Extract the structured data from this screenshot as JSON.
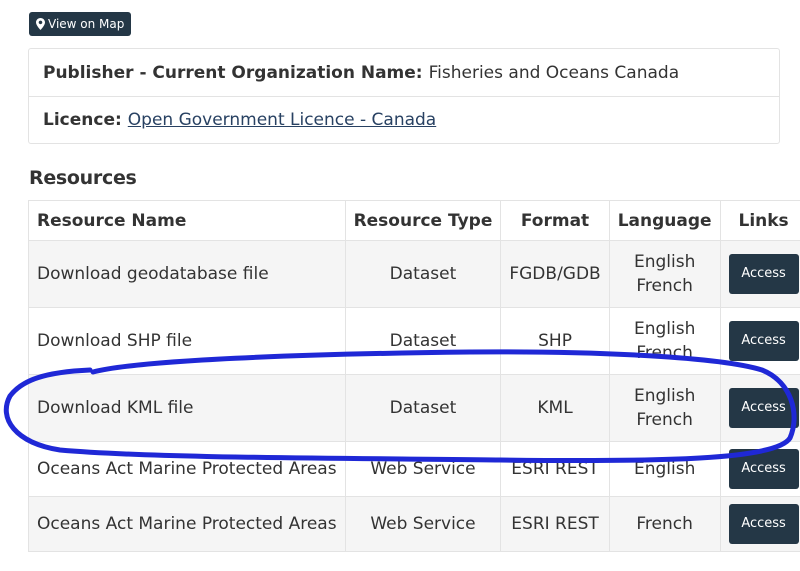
{
  "map_button": {
    "label": "View on Map",
    "icon": "map-marker-icon"
  },
  "publisher": {
    "label": "Publisher - Current Organization Name:",
    "value": "Fisheries and Oceans Canada"
  },
  "licence": {
    "label": "Licence:",
    "value": "Open Government Licence - Canada"
  },
  "resources": {
    "heading": "Resources",
    "columns": [
      "Resource Name",
      "Resource Type",
      "Format",
      "Language",
      "Links"
    ],
    "rows": [
      {
        "name": "Download geodatabase file",
        "type": "Dataset",
        "format": "FGDB/GDB",
        "languages": [
          "English",
          "French"
        ],
        "link": "Access"
      },
      {
        "name": "Download SHP file",
        "type": "Dataset",
        "format": "SHP",
        "languages": [
          "English",
          "French"
        ],
        "link": "Access"
      },
      {
        "name": "Download KML file",
        "type": "Dataset",
        "format": "KML",
        "languages": [
          "English",
          "French"
        ],
        "link": "Access"
      },
      {
        "name": "Oceans Act Marine Protected Areas",
        "type": "Web Service",
        "format": "ESRI REST",
        "languages": [
          "English"
        ],
        "link": "Access"
      },
      {
        "name": "Oceans Act Marine Protected Areas",
        "type": "Web Service",
        "format": "ESRI REST",
        "languages": [
          "French"
        ],
        "link": "Access"
      }
    ]
  },
  "colors": {
    "button_bg": "#243746",
    "link": "#284162",
    "annotation": "#1f28d6"
  }
}
